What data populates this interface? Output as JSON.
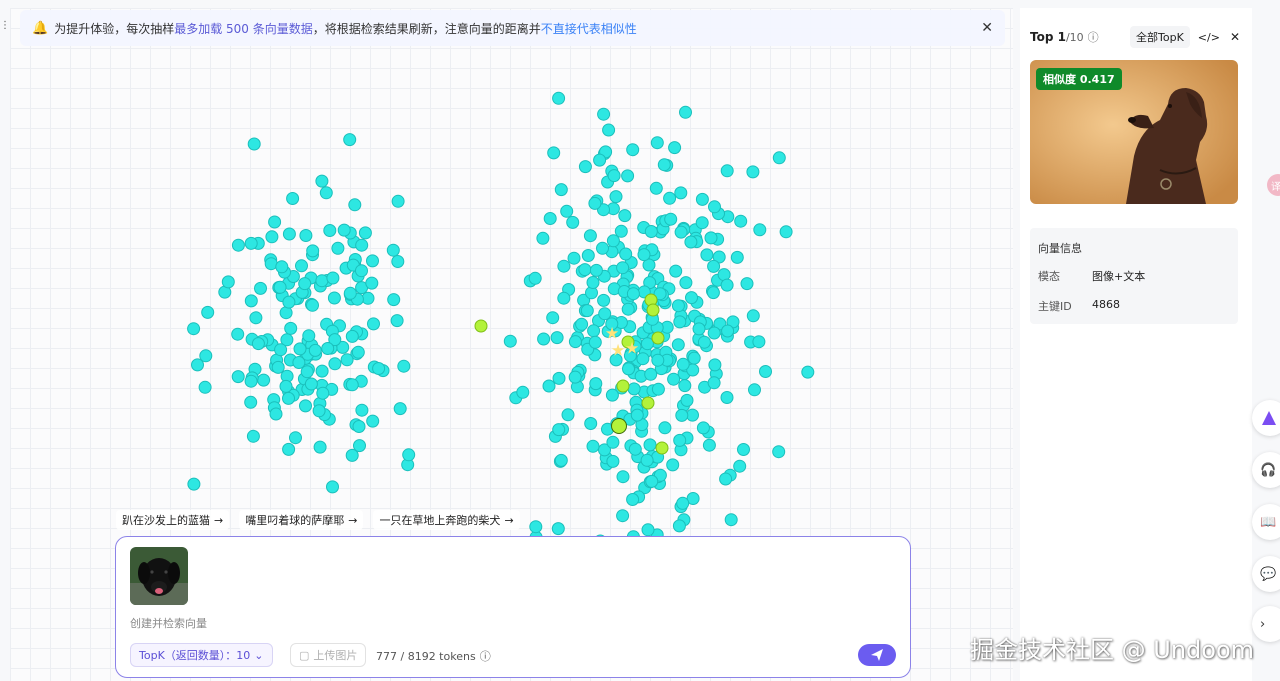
{
  "notice": {
    "prefix": "为提升体验，每次抽样",
    "highlight": "最多加载 500 条向量数据",
    "middle": "，将根据检索结果刷新，注意向量的距离并",
    "link": "不直接代表相似性"
  },
  "suggestions": [
    {
      "label": "趴在沙发上的蓝猫"
    },
    {
      "label": "嘴里叼着球的萨摩耶"
    },
    {
      "label": "一只在草地上奔跑的柴犬"
    }
  ],
  "search": {
    "placeholder": "创建并检索向量",
    "topk_label": "TopK（返回数量）：10",
    "upload_label": "上传图片",
    "tokens": "777 / 8192 tokens"
  },
  "result_panel": {
    "title": "Top 1",
    "title_sub": "/10",
    "all_topk": "全部TopK",
    "code_icon": "</>",
    "similarity": "相似度 0.417",
    "vector_info_title": "向量信息",
    "modality_key": "模态",
    "modality_value": "图像+文本",
    "pk_key": "主键ID",
    "pk_value": "4868"
  },
  "watermark": "掘金技术社区 @ Undoom",
  "colors": {
    "point": "#2de7e2",
    "point_stroke": "#1bbfbb",
    "match": "#b3f23a",
    "match_stroke": "#7fbf17",
    "query_star": "#ffe27a",
    "accent": "#6b5cf0",
    "badge": "#0f8a2a"
  }
}
